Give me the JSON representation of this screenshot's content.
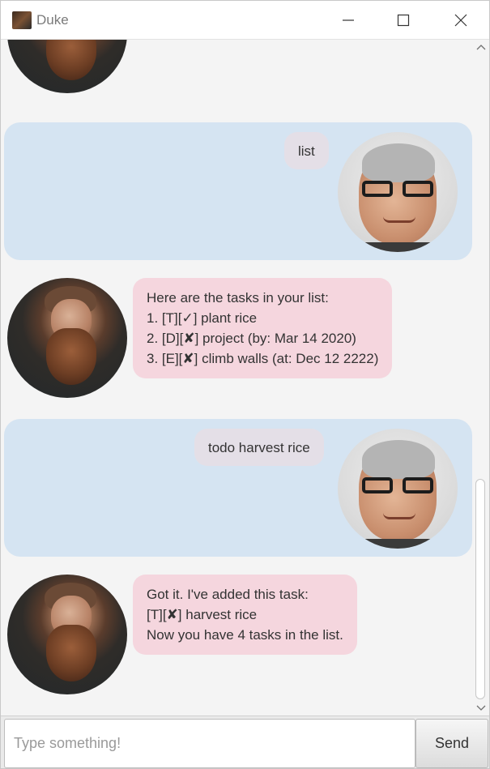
{
  "window": {
    "title": "Duke",
    "icons": {
      "app": "duke-avatar-icon",
      "minimize": "minimize-icon",
      "maximize": "maximize-icon",
      "close": "close-icon"
    }
  },
  "dialog": {
    "messages": [
      {
        "speaker": "user",
        "lines": [
          "list"
        ]
      },
      {
        "speaker": "duke",
        "lines": [
          "Here are the tasks in your list:",
          "1. [T][✓] plant rice",
          "2. [D][✘] project (by: Mar 14 2020)",
          "3. [E][✘] climb walls (at: Dec 12 2222)"
        ]
      },
      {
        "speaker": "user",
        "lines": [
          "todo harvest rice"
        ]
      },
      {
        "speaker": "duke",
        "lines": [
          "Got it. I've added this task:",
          "[T][✘] harvest rice",
          "Now you have 4 tasks in the list."
        ]
      }
    ]
  },
  "input": {
    "placeholder": "Type something!",
    "value": ""
  },
  "send_button": {
    "label": "Send"
  },
  "colors": {
    "user_row": "#d5e4f2",
    "user_bubble": "#e4dfe7",
    "duke_bubble": "#f5d6de",
    "background": "#f4f4f4"
  }
}
